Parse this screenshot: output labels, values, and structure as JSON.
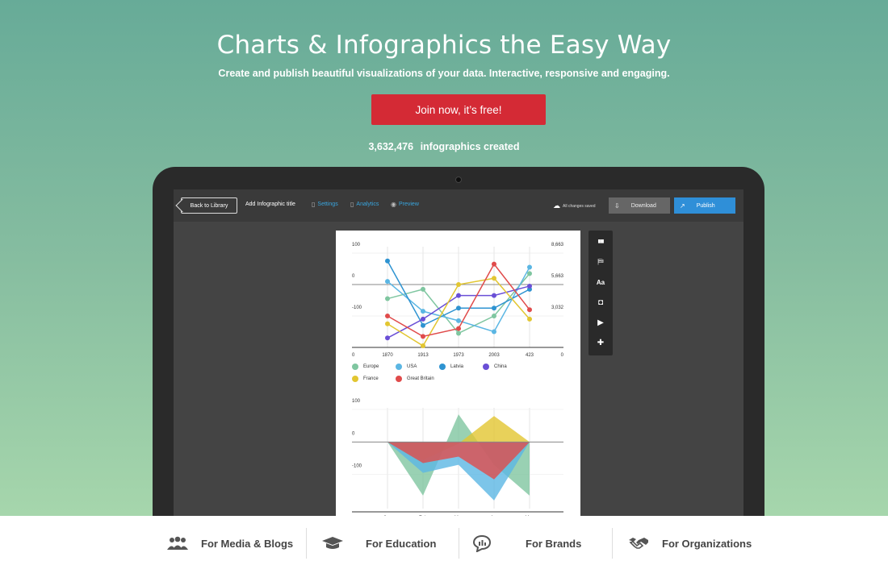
{
  "hero": {
    "title": "Charts & Infographics the Easy Way",
    "subtitle": "Create and publish beautiful visualizations of your data. Interactive, responsive and engaging.",
    "cta_label": "Join now, it’s free!",
    "count_value": "3,632,476",
    "count_label": "infographics created"
  },
  "editor": {
    "back_label": "Back to Library",
    "title_label": "Add Infographic title",
    "settings_label": "Settings",
    "analytics_label": "Analytics",
    "preview_label": "Preview",
    "saved_label": "All changes saved",
    "download_label": "Download",
    "publish_label": "Publish",
    "tools": [
      {
        "name": "chart-tool-icon",
        "glyph": "▮▮▮"
      },
      {
        "name": "map-tool-icon",
        "glyph": "⛿"
      },
      {
        "name": "text-tool-icon",
        "glyph": "Aa"
      },
      {
        "name": "camera-tool-icon",
        "glyph": "◘"
      },
      {
        "name": "video-tool-icon",
        "glyph": "▶"
      },
      {
        "name": "plugin-tool-icon",
        "glyph": "✚"
      }
    ]
  },
  "chart_data": [
    {
      "type": "line",
      "x": [
        "1870",
        "1913",
        "1973",
        "2003",
        "423"
      ],
      "left_ticks": [
        "100",
        "0",
        "-100",
        "0"
      ],
      "right_ticks": [
        "8,663",
        "5,663",
        "3,032",
        "0"
      ],
      "ylim": [
        -200,
        100
      ],
      "series": [
        {
          "name": "Europe",
          "color": "#7fc6a0",
          "values": [
            -45,
            -15,
            -155,
            -100,
            35
          ]
        },
        {
          "name": "USA",
          "color": "#5bb6e3",
          "values": [
            10,
            -85,
            -115,
            -150,
            55
          ]
        },
        {
          "name": "Latvia",
          "color": "#2e93d1",
          "values": [
            75,
            -130,
            -75,
            -75,
            -15
          ]
        },
        {
          "name": "China",
          "color": "#6a4fd6",
          "values": [
            -170,
            -110,
            -35,
            -35,
            -5
          ]
        },
        {
          "name": "France",
          "color": "#e2c631",
          "values": [
            -125,
            -195,
            0,
            20,
            -110
          ]
        },
        {
          "name": "Great Britain",
          "color": "#e04b4b",
          "values": [
            -100,
            -165,
            -140,
            65,
            -80
          ]
        }
      ]
    },
    {
      "type": "area",
      "x": [
        "Jan",
        "Feb",
        "Mar",
        "Apr",
        "May"
      ],
      "left_ticks": [
        "100",
        "0",
        "-100"
      ],
      "ylim": [
        -200,
        100
      ],
      "series": [
        {
          "name": "Europe",
          "color": "#7fc6a0",
          "values": [
            0,
            -165,
            85,
            -70,
            -165
          ]
        },
        {
          "name": "France",
          "color": "#e2c631",
          "values": [
            0,
            -55,
            -5,
            80,
            0
          ]
        },
        {
          "name": "USA",
          "color": "#5bb6e3",
          "values": [
            0,
            -95,
            -70,
            -180,
            0
          ]
        },
        {
          "name": "Great Britain",
          "color": "#e04b4b",
          "values": [
            0,
            -65,
            -45,
            -115,
            0
          ]
        }
      ]
    }
  ],
  "nav": [
    {
      "label": "For Media & Blogs",
      "icon": "people-icon"
    },
    {
      "label": "For Education",
      "icon": "graduation-cap-icon"
    },
    {
      "label": "For Brands",
      "icon": "chat-chart-icon"
    },
    {
      "label": "For Organizations",
      "icon": "handshake-icon"
    }
  ]
}
